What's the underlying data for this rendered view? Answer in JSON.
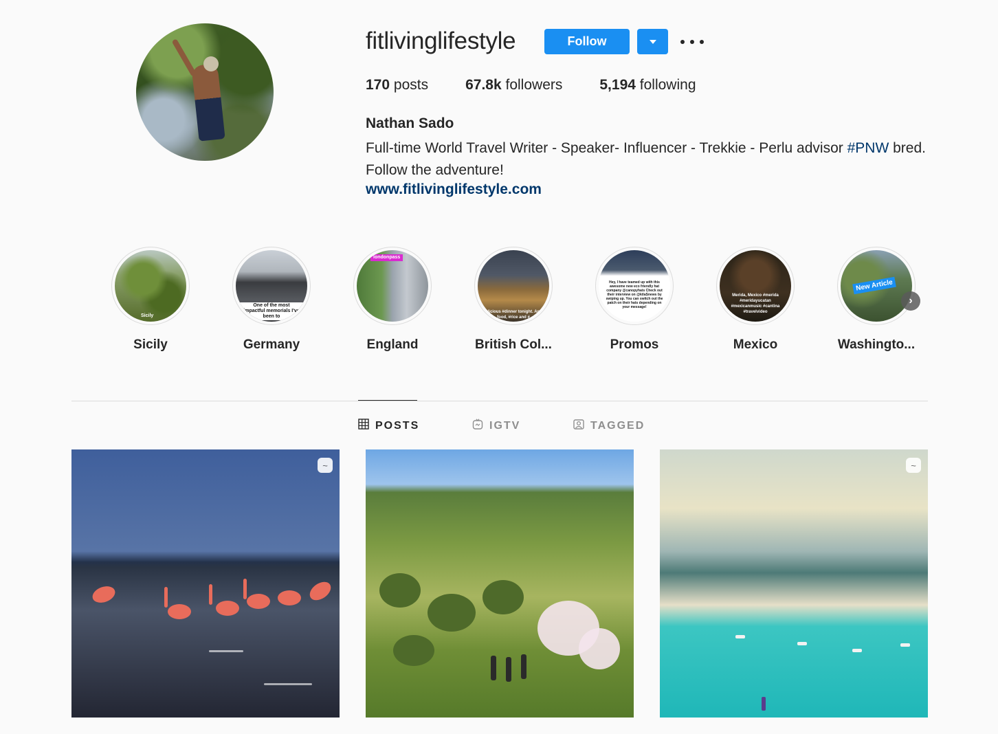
{
  "profile": {
    "username": "fitlivinglifestyle",
    "follow_label": "Follow",
    "stats": {
      "posts_count": "170",
      "posts_label": "posts",
      "followers_count": "67.8k",
      "followers_label": "followers",
      "following_count": "5,194",
      "following_label": "following"
    },
    "full_name": "Nathan Sado",
    "bio_text": "Full-time World Travel Writer - Speaker- Influencer - Trekkie - Perlu advisor ",
    "bio_hashtag": "#PNW",
    "bio_text_2": " bred. Follow the adventure!",
    "website": "www.fitlivinglifestyle.com"
  },
  "highlights": [
    {
      "label": "Sicily",
      "image_text": "Sicily"
    },
    {
      "label": "Germany",
      "image_text": "One of the most impactful memorials I've been to"
    },
    {
      "label": "England",
      "image_text": "londonpass"
    },
    {
      "label": "British Col...",
      "image_text": "Delicious #dinner tonight. An #i food, #rice and #"
    },
    {
      "label": "Promos",
      "image_text": "Hey, I have teamed up with this awesome new eco friendly hat company @canopyhats Check out their interview on @ktlaSnews by swiping up. You can switch out the patch on their hats depending on your message!"
    },
    {
      "label": "Mexico",
      "image_text": "Merida, Mexico #merida #meridayucatan #mexicanmusic #cantina #travelvideo"
    },
    {
      "label": "Washingto...",
      "image_text": "New Article"
    }
  ],
  "tabs": [
    {
      "label": "POSTS",
      "icon": "grid-icon",
      "active": true
    },
    {
      "label": "IGTV",
      "icon": "igtv-icon",
      "active": false
    },
    {
      "label": "TAGGED",
      "icon": "tagged-icon",
      "active": false
    }
  ],
  "colors": {
    "accent": "#1a8ff2",
    "link": "#00376b",
    "background": "#fafafa"
  }
}
